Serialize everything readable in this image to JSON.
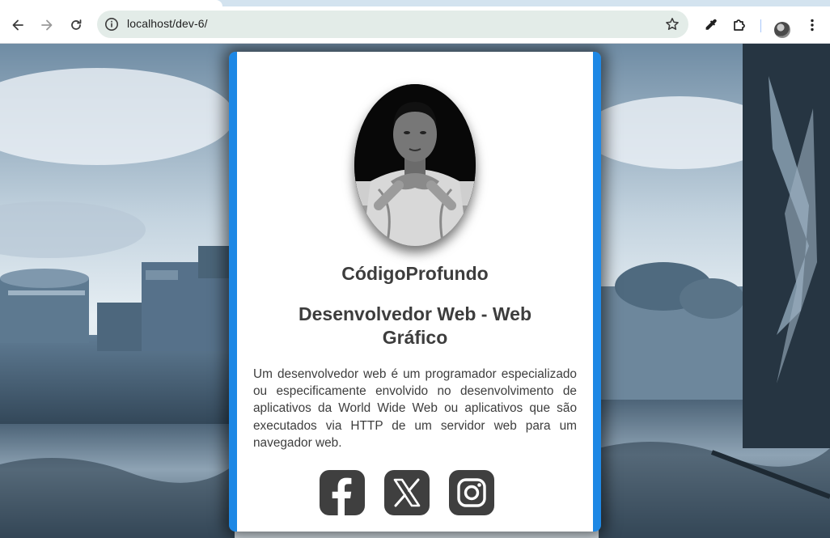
{
  "browser": {
    "url": "localhost/dev-6/"
  },
  "profile": {
    "name": "CódigoProfundo",
    "title": "Desenvolvedor Web - Web Gráfico",
    "description": "Um desenvolvedor web é um programador especializado ou especificamente envolvido no desenvolvimento de aplicativos da World Wide Web ou aplicativos que são executados via HTTP de um servidor web para um navegador web."
  },
  "socials": [
    {
      "icon": "facebook-icon"
    },
    {
      "icon": "x-twitter-icon"
    },
    {
      "icon": "instagram-icon"
    }
  ],
  "colors": {
    "card_border": "#1e88e5",
    "text": "#3d3d3d",
    "social_bg": "#3f3f3f"
  }
}
